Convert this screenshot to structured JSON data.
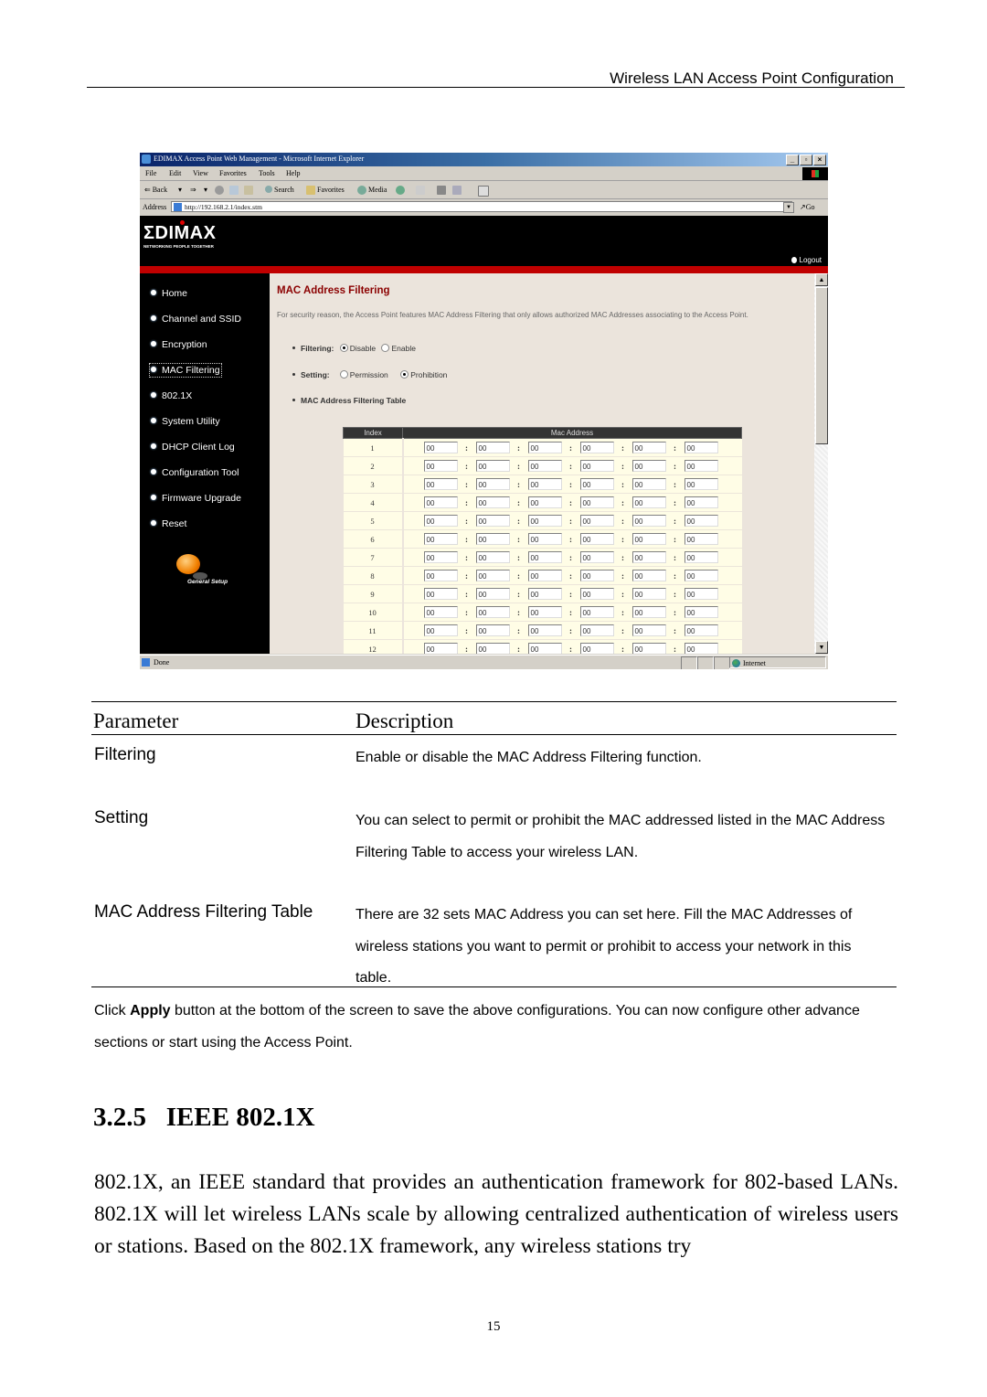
{
  "running_header": "Wireless LAN Access Point Configuration",
  "browser": {
    "window_title": "EDIMAX Access Point Web Management - Microsoft Internet Explorer",
    "window_buttons": [
      "_",
      "▫",
      "×"
    ],
    "menu": [
      "File",
      "Edit",
      "View",
      "Favorites",
      "Tools",
      "Help"
    ],
    "toolbar": {
      "back": "⇐ Back",
      "back_drop": "▾",
      "forward": "⇒",
      "forward_drop": "▾",
      "search": "Search",
      "favorites": "Favorites",
      "media": "Media"
    },
    "address_label": "Address",
    "address_value": "http://192.168.2.1/index.stm",
    "go_label": "Go",
    "status_text": "Done",
    "status_zone": "Internet"
  },
  "webapp": {
    "logo": "ΣDIMAX",
    "tagline": "NETWORKING PEOPLE TOGETHER",
    "logout": "Logout",
    "nav": [
      {
        "label": "Home"
      },
      {
        "label": "Channel and SSID"
      },
      {
        "label": "Encryption"
      },
      {
        "label": "MAC Filtering",
        "active": true
      },
      {
        "label": "802.1X"
      },
      {
        "label": "System Utility"
      },
      {
        "label": "DHCP Client Log"
      },
      {
        "label": "Configuration Tool"
      },
      {
        "label": "Firmware Upgrade"
      },
      {
        "label": "Reset"
      }
    ],
    "general_setup": "General Setup",
    "content": {
      "title": "MAC Address Filtering",
      "description": "For security reason, the Access Point features MAC Address Filtering that only allows authorized MAC Addresses associating to the Access Point.",
      "filtering": {
        "label": "Filtering:",
        "options": [
          "Disable",
          "Enable"
        ],
        "selected": "Disable"
      },
      "setting": {
        "label": "Setting:",
        "options": [
          "Permission",
          "Prohibition"
        ],
        "selected": "Prohibition"
      },
      "table_label": "MAC Address Filtering Table",
      "table": {
        "headers": [
          "Index",
          "Mac Address"
        ],
        "separator": ":",
        "rows": [
          {
            "index": "1",
            "octets": [
              "00",
              "00",
              "00",
              "00",
              "00",
              "00"
            ]
          },
          {
            "index": "2",
            "octets": [
              "00",
              "00",
              "00",
              "00",
              "00",
              "00"
            ]
          },
          {
            "index": "3",
            "octets": [
              "00",
              "00",
              "00",
              "00",
              "00",
              "00"
            ]
          },
          {
            "index": "4",
            "octets": [
              "00",
              "00",
              "00",
              "00",
              "00",
              "00"
            ]
          },
          {
            "index": "5",
            "octets": [
              "00",
              "00",
              "00",
              "00",
              "00",
              "00"
            ]
          },
          {
            "index": "6",
            "octets": [
              "00",
              "00",
              "00",
              "00",
              "00",
              "00"
            ]
          },
          {
            "index": "7",
            "octets": [
              "00",
              "00",
              "00",
              "00",
              "00",
              "00"
            ]
          },
          {
            "index": "8",
            "octets": [
              "00",
              "00",
              "00",
              "00",
              "00",
              "00"
            ]
          },
          {
            "index": "9",
            "octets": [
              "00",
              "00",
              "00",
              "00",
              "00",
              "00"
            ]
          },
          {
            "index": "10",
            "octets": [
              "00",
              "00",
              "00",
              "00",
              "00",
              "00"
            ]
          },
          {
            "index": "11",
            "octets": [
              "00",
              "00",
              "00",
              "00",
              "00",
              "00"
            ]
          },
          {
            "index": "12",
            "octets": [
              "00",
              "00",
              "00",
              "00",
              "00",
              "00"
            ]
          }
        ]
      }
    }
  },
  "param_table": {
    "headers": [
      "Parameter",
      "Description"
    ],
    "rows": [
      {
        "name": "Filtering",
        "desc": "Enable or disable the MAC Address Filtering function."
      },
      {
        "name": "Setting",
        "desc": "You can select to permit or prohibit the MAC addressed listed in the MAC Address Filtering Table to access your wireless LAN."
      },
      {
        "name": "MAC Address Filtering Table",
        "desc": "There are 32 sets MAC Address you can set here. Fill the MAC Addresses of wireless stations you want to permit or prohibit to access your network in this table."
      }
    ]
  },
  "note": {
    "prefix": "Click ",
    "bold": "Apply",
    "suffix": " button at the bottom of the screen to save the above configurations. You can now configure other advance sections or start using the Access Point."
  },
  "section": {
    "number": "3.2.5",
    "title": "IEEE 802.1X",
    "body": "802.1X, an IEEE standard that provides an authentication framework for 802-based LANs. 802.1X will let wireless LANs scale by allowing centralized authentication of wireless users or stations. Based on the 802.1X framework, any wireless stations try"
  },
  "page_number": "15"
}
